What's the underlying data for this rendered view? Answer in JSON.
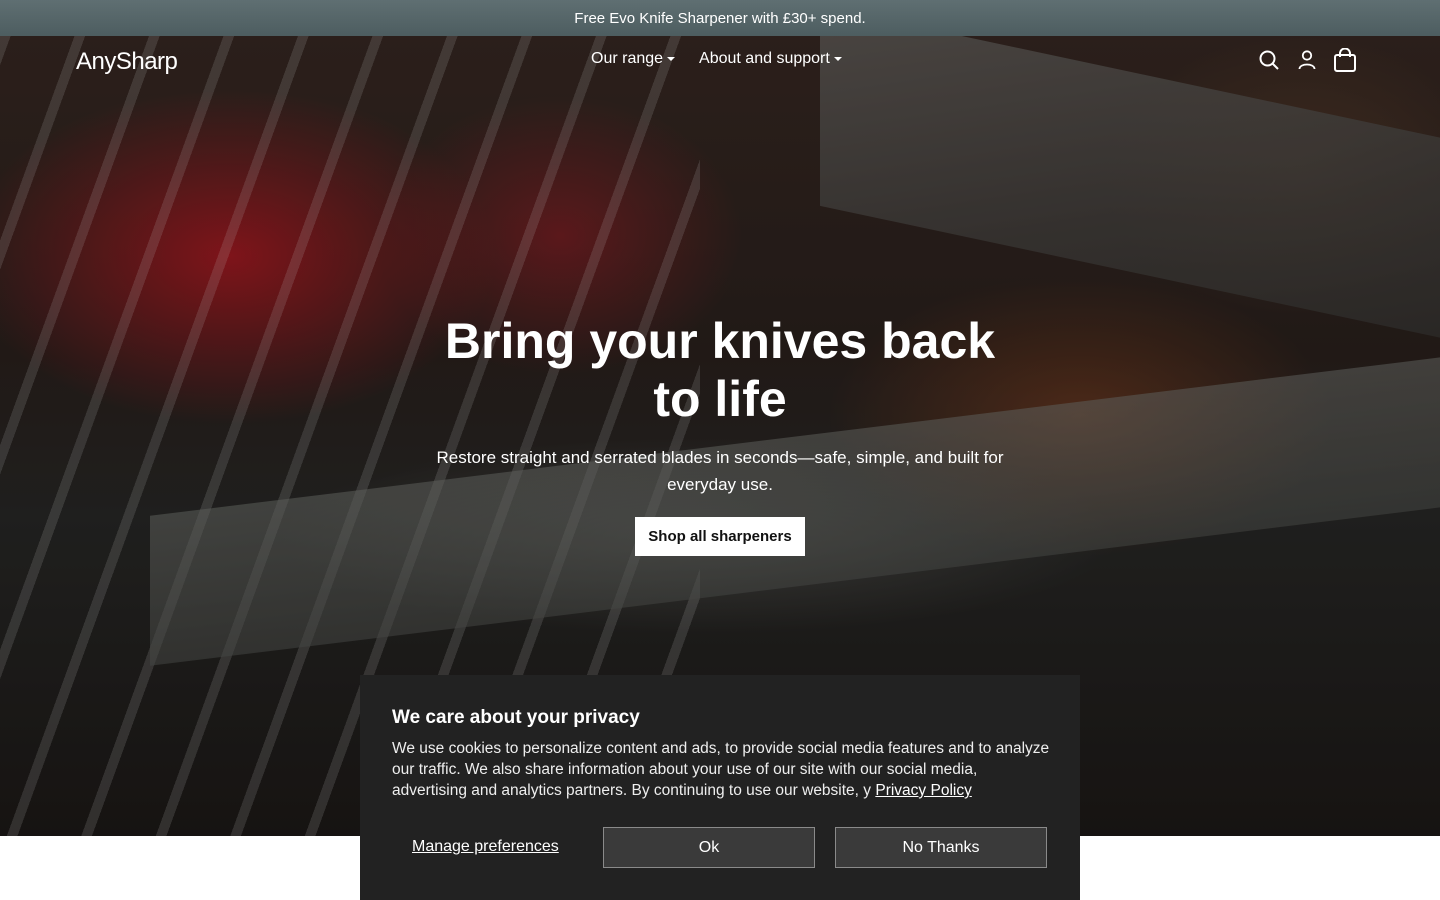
{
  "announcement": {
    "text": "Free Evo Knife Sharpener with £30+ spend."
  },
  "header": {
    "logo": "AnySharp",
    "nav": [
      "Our range",
      "About and support"
    ],
    "icons": [
      "search-icon",
      "account-icon",
      "cart-icon"
    ]
  },
  "hero": {
    "headline": "Bring your knives back to life",
    "subcopy": "Restore straight and serrated blades in seconds—safe, simple, and built for everyday use.",
    "cta": "Shop all sharpeners"
  },
  "cookie": {
    "title": "We care about your privacy",
    "body": "We use cookies to personalize content and ads, to provide social media features and to analyze our traffic. We also share information about your use of our site with our social media, advertising and analytics partners. By continuing to use our website, y",
    "link": "Privacy Policy",
    "manage": "Manage preferences",
    "ok": "Ok",
    "no_thanks": "No Thanks"
  },
  "colors": {
    "announcement_bg": "#5a6a6d",
    "cookie_bg": "#222222",
    "cta_bg": "#ffffff"
  }
}
